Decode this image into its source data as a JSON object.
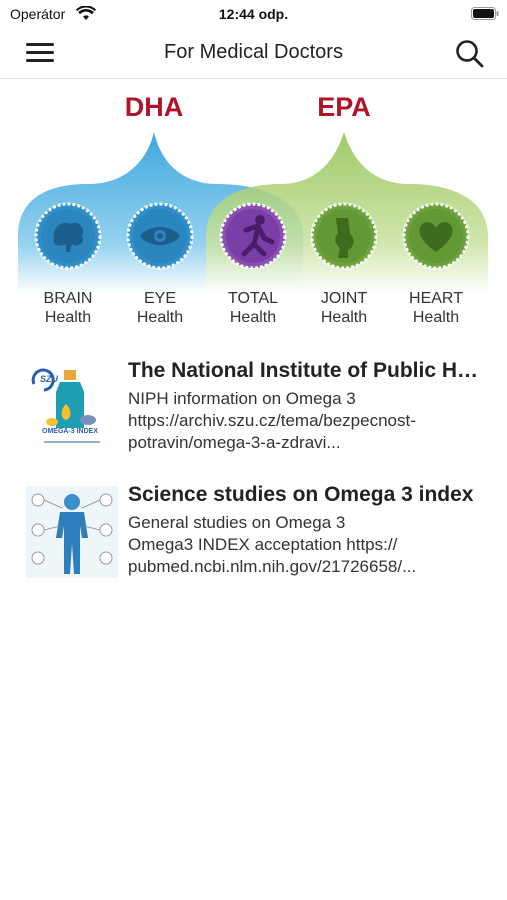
{
  "status_bar": {
    "carrier": "Operátor",
    "time": "12:44 odp."
  },
  "nav": {
    "title": "For Medical Doctors"
  },
  "banner": {
    "left_heading": "DHA",
    "right_heading": "EPA",
    "dha_color": "#3aa7dd",
    "epa_color": "#8fc04c",
    "heading_color": "#b0142a",
    "items": [
      {
        "icon": "brain-icon",
        "line1": "BRAIN",
        "line2": "Health"
      },
      {
        "icon": "eye-icon",
        "line1": "EYE",
        "line2": "Health"
      },
      {
        "icon": "running-person-icon",
        "line1": "TOTAL",
        "line2": "Health"
      },
      {
        "icon": "joint-icon",
        "line1": "JOINT",
        "line2": "Health"
      },
      {
        "icon": "heart-icon",
        "line1": "HEART",
        "line2": "Health"
      }
    ]
  },
  "articles": [
    {
      "title": "The National Institute of Public Health",
      "desc1": "NIPH information on Omega 3",
      "desc2": "https://archiv.szu.cz/tema/bezpecnost-",
      "desc3": "potravin/omega-3-a-zdravi...",
      "thumb_caption": "OMEGA-3 INDEX",
      "thumb_logo": "SZU"
    },
    {
      "title": "Science studies on Omega 3 index",
      "desc1": "General studies on Omega 3",
      "desc2": "Omega3 INDEX acceptation https://",
      "desc3": "pubmed.ncbi.nlm.nih.gov/21726658/..."
    }
  ]
}
